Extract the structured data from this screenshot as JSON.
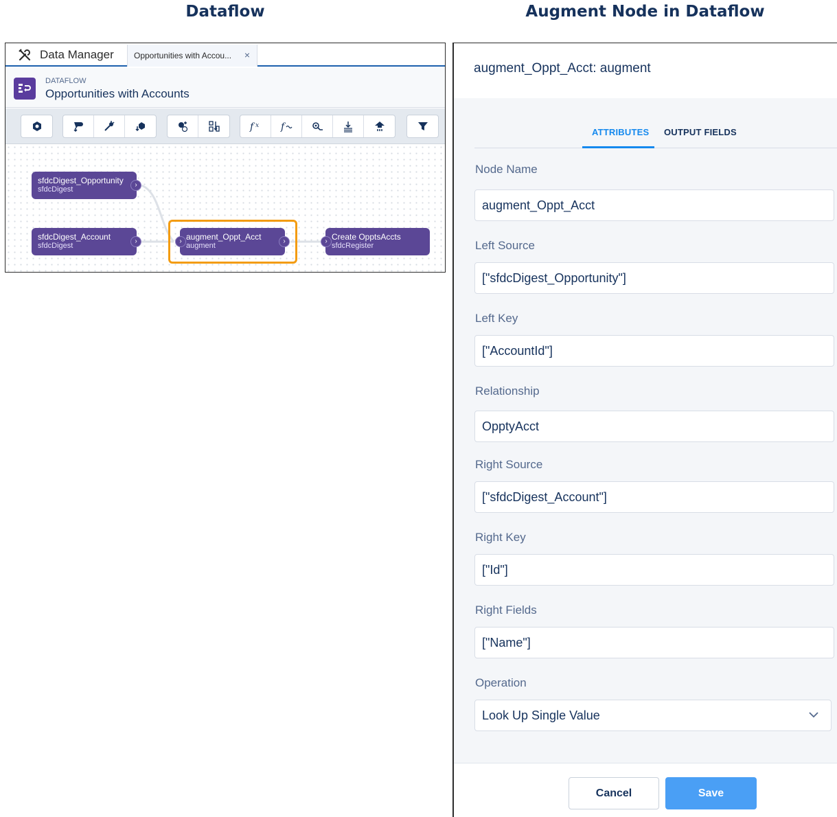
{
  "captions": {
    "left": "Dataflow",
    "right": "Augment Node in Dataflow"
  },
  "data_manager": {
    "app_name": "Data Manager",
    "tab_label": "Opportunities with Accou...",
    "tab_close": "×",
    "kicker": "DATAFLOW",
    "title": "Opportunities with Accounts",
    "toolbar_icons": [
      "sfdc-digest-icon",
      "digest-icon",
      "edgemart-icon",
      "append-icon",
      "augment-icon",
      "compute-expression-icon",
      "compute-relative-icon",
      "dim2mea-icon",
      "flatten-icon",
      "sfdc-register-icon",
      "filter-icon"
    ],
    "nodes": [
      {
        "name": "sfdcDigest_Opportunity",
        "type": "sfdcDigest"
      },
      {
        "name": "sfdcDigest_Account",
        "type": "sfdcDigest"
      },
      {
        "name": "augment_Oppt_Acct",
        "type": "augment"
      },
      {
        "name": "Create OpptsAccts",
        "type": "sfdcRegister"
      }
    ],
    "highlight_color": "#f39c12",
    "node_color": "#5b4796"
  },
  "panel": {
    "title": "augment_Oppt_Acct: augment",
    "tabs": [
      {
        "label": "ATTRIBUTES",
        "active": true
      },
      {
        "label": "OUTPUT FIELDS",
        "active": false
      }
    ],
    "fields": [
      {
        "label": "Node Name",
        "value": "augment_Oppt_Acct"
      },
      {
        "label": "Left Source",
        "value": "[\"sfdcDigest_Opportunity\"]"
      },
      {
        "label": "Left Key",
        "value": "[\"AccountId\"]"
      },
      {
        "label": "Relationship",
        "value": "OpptyAcct"
      },
      {
        "label": "Right Source",
        "value": "[\"sfdcDigest_Account\"]"
      },
      {
        "label": "Right Key",
        "value": "[\"Id\"]"
      },
      {
        "label": "Right Fields",
        "value": "[\"Name\"]"
      },
      {
        "label": "Operation",
        "value": "Look Up Single Value"
      }
    ],
    "cancel_label": "Cancel",
    "save_label": "Save",
    "accent_color": "#1589ee"
  }
}
